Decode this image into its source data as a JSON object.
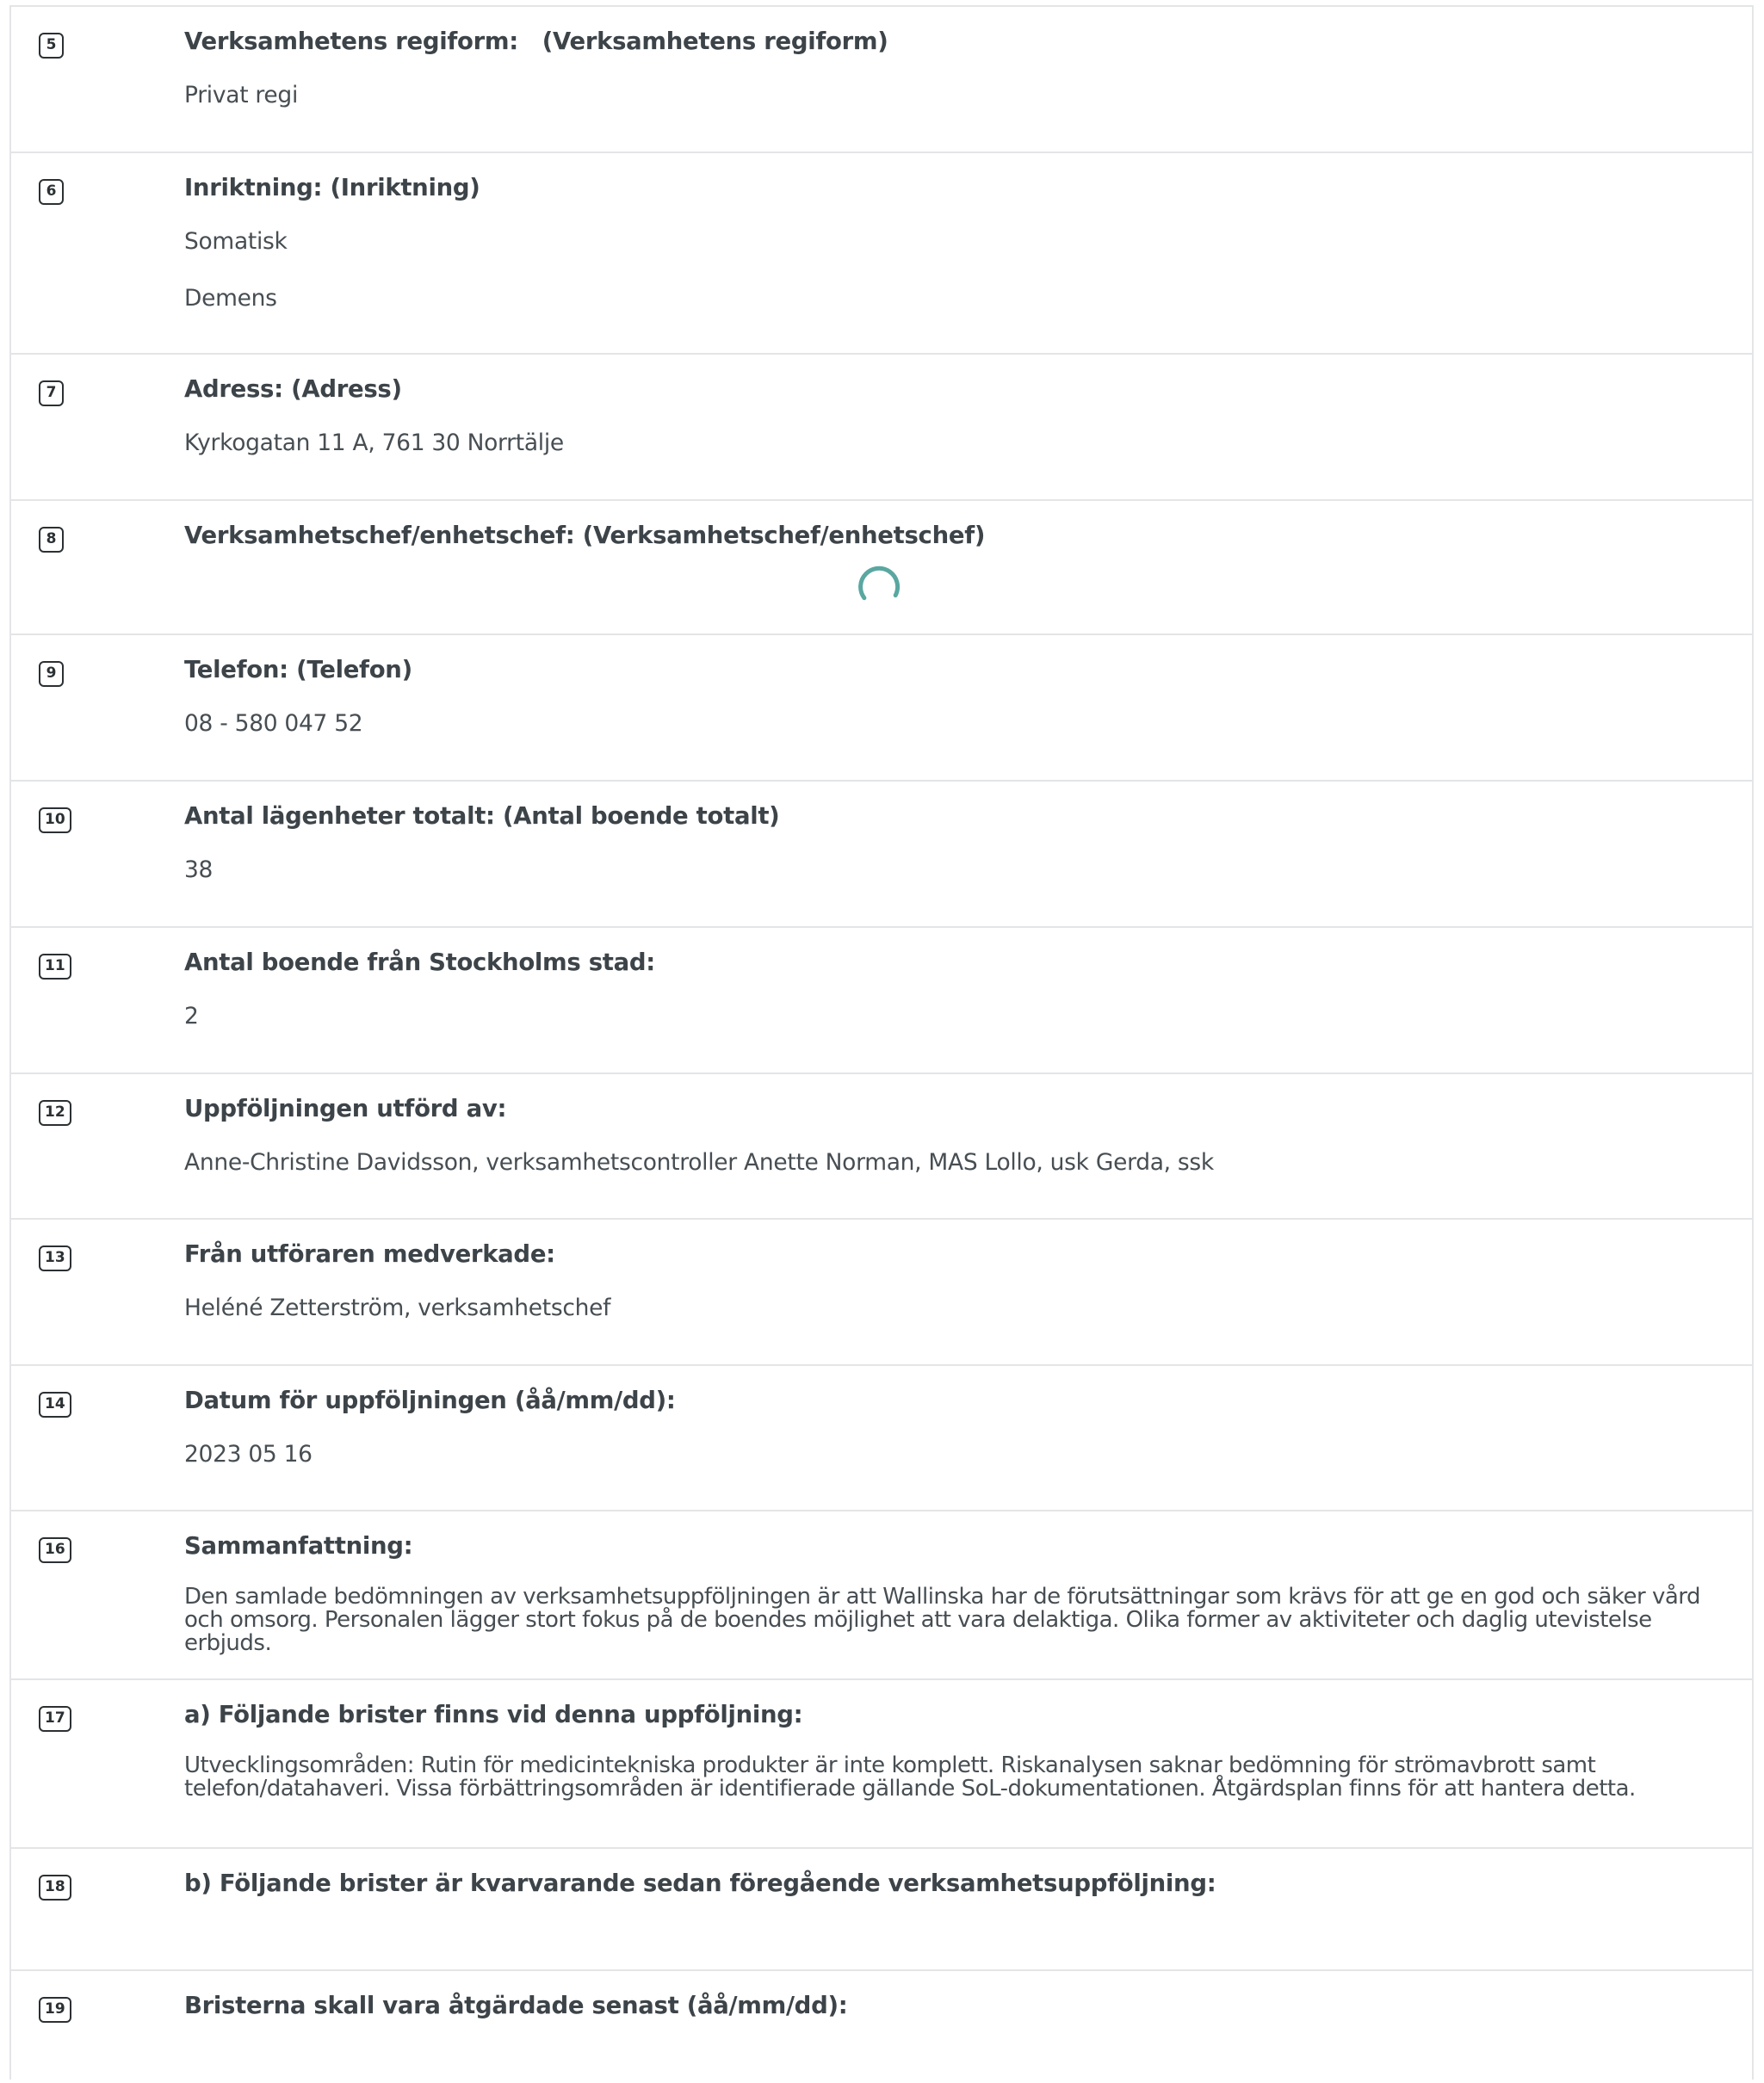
{
  "rows": [
    {
      "num": "5",
      "label": "Verksamhetens regiform:   (Verksamhetens regiform)",
      "values": [
        "Privat regi"
      ]
    },
    {
      "num": "6",
      "label": "Inriktning: (Inriktning)",
      "values": [
        "Somatisk",
        "Demens"
      ]
    },
    {
      "num": "7",
      "label": "Adress: (Adress)",
      "values": [
        "Kyrkogatan 11 A, 761 30 Norrtälje"
      ]
    },
    {
      "num": "8",
      "label": "Verksamhetschef/enhetschef: (Verksamhetschef/enhetschef)",
      "values": []
    },
    {
      "num": "9",
      "label": "Telefon: (Telefon)",
      "values": [
        "08 - 580 047 52"
      ]
    },
    {
      "num": "10",
      "label": "Antal lägenheter totalt: (Antal boende totalt)",
      "values": [
        "38"
      ]
    },
    {
      "num": "11",
      "label": "Antal boende från Stockholms stad:",
      "values": [
        "2"
      ]
    },
    {
      "num": "12",
      "label": "Uppföljningen utförd av:",
      "values": [
        "Anne-Christine Davidsson, verksamhetscontroller Anette Norman, MAS Lollo, usk Gerda, ssk"
      ]
    },
    {
      "num": "13",
      "label": "Från utföraren medverkade:",
      "values": [
        "Heléné Zetterström, verksamhetschef"
      ]
    },
    {
      "num": "14",
      "label": "Datum för uppföljningen (åå/mm/dd):",
      "values": [
        "2023 05 16"
      ]
    },
    {
      "num": "16",
      "label": "Sammanfattning:",
      "paragraph": "Den samlade bedömningen av verksamhetsuppföljningen är att Wallinska har de förutsättningar som krävs för att ge en god och säker vård och omsorg. Personalen lägger stort fokus på de boendes möjlighet att vara delaktiga. Olika former av aktiviteter och daglig utevistelse erbjuds."
    },
    {
      "num": "17",
      "label": "a) Följande brister finns vid denna uppföljning:",
      "paragraph": "Utvecklingsområden: Rutin för medicintekniska produkter är inte komplett. Riskanalysen saknar bedömning för strömavbrott samt telefon/datahaveri. Vissa förbättringsområden är identifierade gällande SoL-dokumentationen. Åtgärdsplan finns för att hantera detta."
    },
    {
      "num": "18",
      "label": "b) Följande brister är kvarvarande sedan föregående verksamhetsuppföljning:",
      "values": []
    },
    {
      "num": "19",
      "label": "Bristerna skall vara åtgärdade senast (åå/mm/dd):",
      "values": []
    }
  ],
  "spinner_color": "#5aa7a1"
}
